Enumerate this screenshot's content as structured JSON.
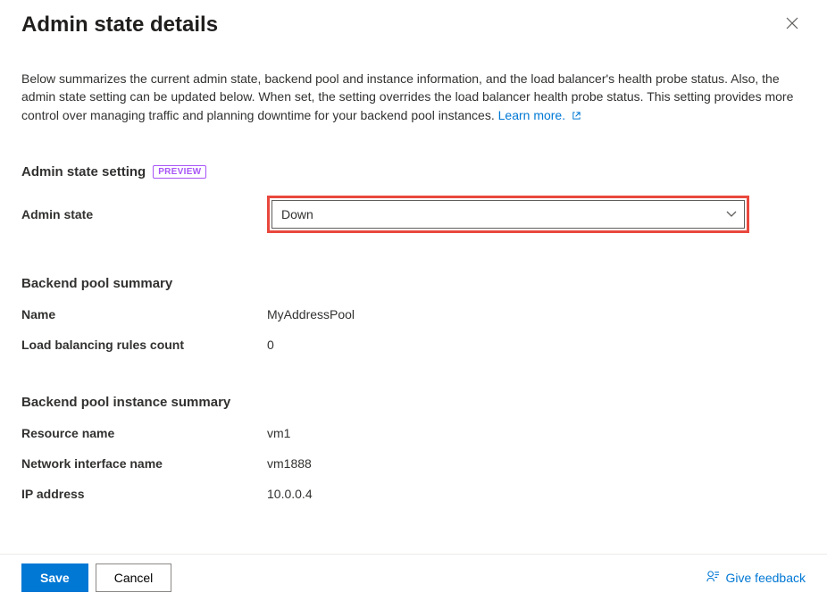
{
  "header": {
    "title": "Admin state details"
  },
  "description": {
    "text": "Below summarizes the current admin state, backend pool and instance information, and the load balancer's health probe status. Also, the admin state setting can be updated below. When set, the setting overrides the load balancer health probe status. This setting provides more control over managing traffic and planning downtime for your backend pool instances. ",
    "learn_more": "Learn more."
  },
  "admin_state_section": {
    "heading": "Admin state setting",
    "badge": "PREVIEW",
    "label": "Admin state",
    "value": "Down"
  },
  "backend_pool_summary": {
    "heading": "Backend pool summary",
    "rows": {
      "name_label": "Name",
      "name_value": "MyAddressPool",
      "rules_label": "Load balancing rules count",
      "rules_value": "0"
    }
  },
  "instance_summary": {
    "heading": "Backend pool instance summary",
    "rows": {
      "resource_label": "Resource name",
      "resource_value": "vm1",
      "nic_label": "Network interface name",
      "nic_value": "vm1888",
      "ip_label": "IP address",
      "ip_value": "10.0.0.4"
    }
  },
  "footer": {
    "save": "Save",
    "cancel": "Cancel",
    "feedback": "Give feedback"
  }
}
